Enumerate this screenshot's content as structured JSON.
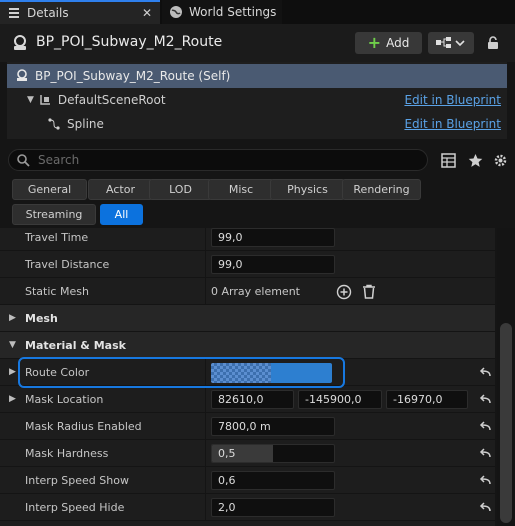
{
  "tabs": [
    {
      "label": "Details",
      "icon": "details-icon",
      "close": "✕"
    },
    {
      "label": "World Settings",
      "icon": "globe-icon"
    }
  ],
  "header": {
    "actor_name": "BP_POI_Subway_M2_Route",
    "add_label": "Add"
  },
  "tree": {
    "self_label": "BP_POI_Subway_M2_Route (Self)",
    "items": [
      {
        "label": "DefaultSceneRoot",
        "edit": "Edit in Blueprint"
      },
      {
        "label": "Spline",
        "edit": "Edit in Blueprint"
      }
    ]
  },
  "search": {
    "placeholder": "Search"
  },
  "filters": [
    "General",
    "Actor",
    "LOD",
    "Misc",
    "Physics",
    "Rendering",
    "Streaming",
    "All"
  ],
  "active_filter": "All",
  "properties": {
    "travel_time": {
      "label": "Travel Time",
      "value": "99,0"
    },
    "travel_distance": {
      "label": "Travel Distance",
      "value": "99,0"
    },
    "static_mesh": {
      "label": "Static Mesh",
      "value": "0 Array element"
    },
    "mesh_category": "Mesh",
    "material_category": "Material & Mask",
    "route_color": {
      "label": "Route Color",
      "color": "#2d7fd0"
    },
    "mask_location": {
      "label": "Mask Location",
      "x": "82610,0",
      "y": "-145900,0",
      "z": "-16970,0"
    },
    "mask_radius": {
      "label": "Mask Radius Enabled",
      "value": "7800,0 m"
    },
    "mask_hardness": {
      "label": "Mask Hardness",
      "value": "0,5",
      "fill": 0.5
    },
    "interp_show": {
      "label": "Interp Speed Show",
      "value": "0,6"
    },
    "interp_hide": {
      "label": "Interp Speed Hide",
      "value": "2,0"
    }
  },
  "colors": {
    "accent": "#0c72de",
    "link": "#5aa2e6",
    "selection": "#4a5a72"
  }
}
